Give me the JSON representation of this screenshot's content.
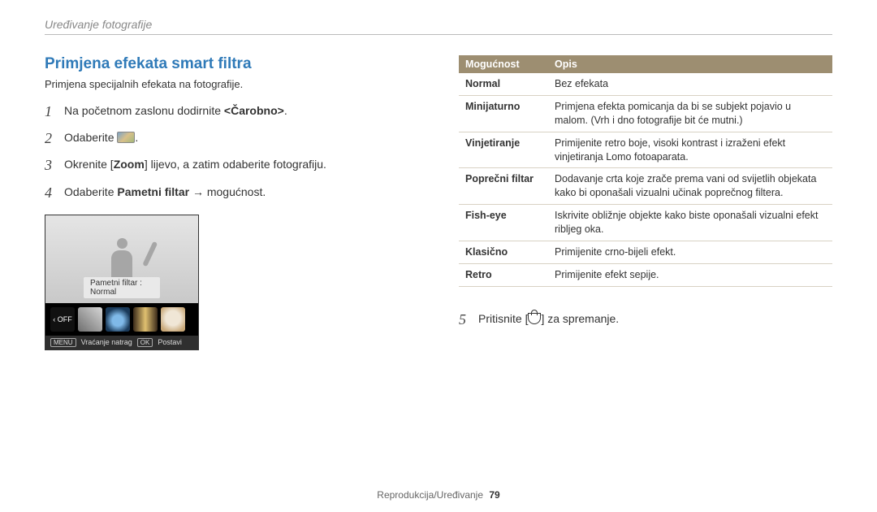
{
  "header": {
    "breadcrumb": "Uređivanje fotografije"
  },
  "section": {
    "title": "Primjena efekata smart filtra",
    "subtitle": "Primjena specijalnih efekata na fotografije."
  },
  "steps": {
    "s1": {
      "num": "1",
      "pre": "Na početnom zaslonu dodirnite ",
      "bold": "<Čarobno>",
      "post": "."
    },
    "s2": {
      "num": "2",
      "pre": "Odaberite ",
      "post": "."
    },
    "s3": {
      "num": "3",
      "pre": "Okrenite [",
      "bold": "Zoom",
      "post": "] lijevo, a zatim odaberite fotografiju."
    },
    "s4": {
      "num": "4",
      "pre": "Odaberite ",
      "bold": "Pametni filtar",
      "post": " → mogućnost."
    },
    "s5": {
      "num": "5",
      "pre": "Pritisnite [",
      "post": "] za spremanje."
    }
  },
  "preview": {
    "label": "Pametni filtar : Normal",
    "off": "‹ OFF",
    "menu_btn": "MENU",
    "menu_txt": "Vraćanje natrag",
    "ok_btn": "OK",
    "ok_txt": "Postavi"
  },
  "table": {
    "h1": "Mogućnost",
    "h2": "Opis",
    "rows": [
      {
        "name": "Normal",
        "desc": "Bez efekata"
      },
      {
        "name": "Minijaturno",
        "desc": "Primjena efekta pomicanja da bi se subjekt pojavio u malom. (Vrh i dno fotografije bit će mutni.)"
      },
      {
        "name": "Vinjetiranje",
        "desc": "Primijenite retro boje, visoki kontrast i izraženi efekt vinjetiranja Lomo fotoaparata."
      },
      {
        "name": "Poprečni filtar",
        "desc": "Dodavanje crta koje zrače prema vani od svijetlih objekata kako bi oponašali vizualni učinak poprečnog filtera."
      },
      {
        "name": "Fish-eye",
        "desc": "Iskrivite obližnje objekte kako biste oponašali vizualni efekt ribljeg oka."
      },
      {
        "name": "Klasično",
        "desc": "Primijenite crno-bijeli efekt."
      },
      {
        "name": "Retro",
        "desc": "Primijenite efekt sepije."
      }
    ]
  },
  "footer": {
    "text": "Reprodukcija/Uređivanje",
    "page": "79"
  }
}
